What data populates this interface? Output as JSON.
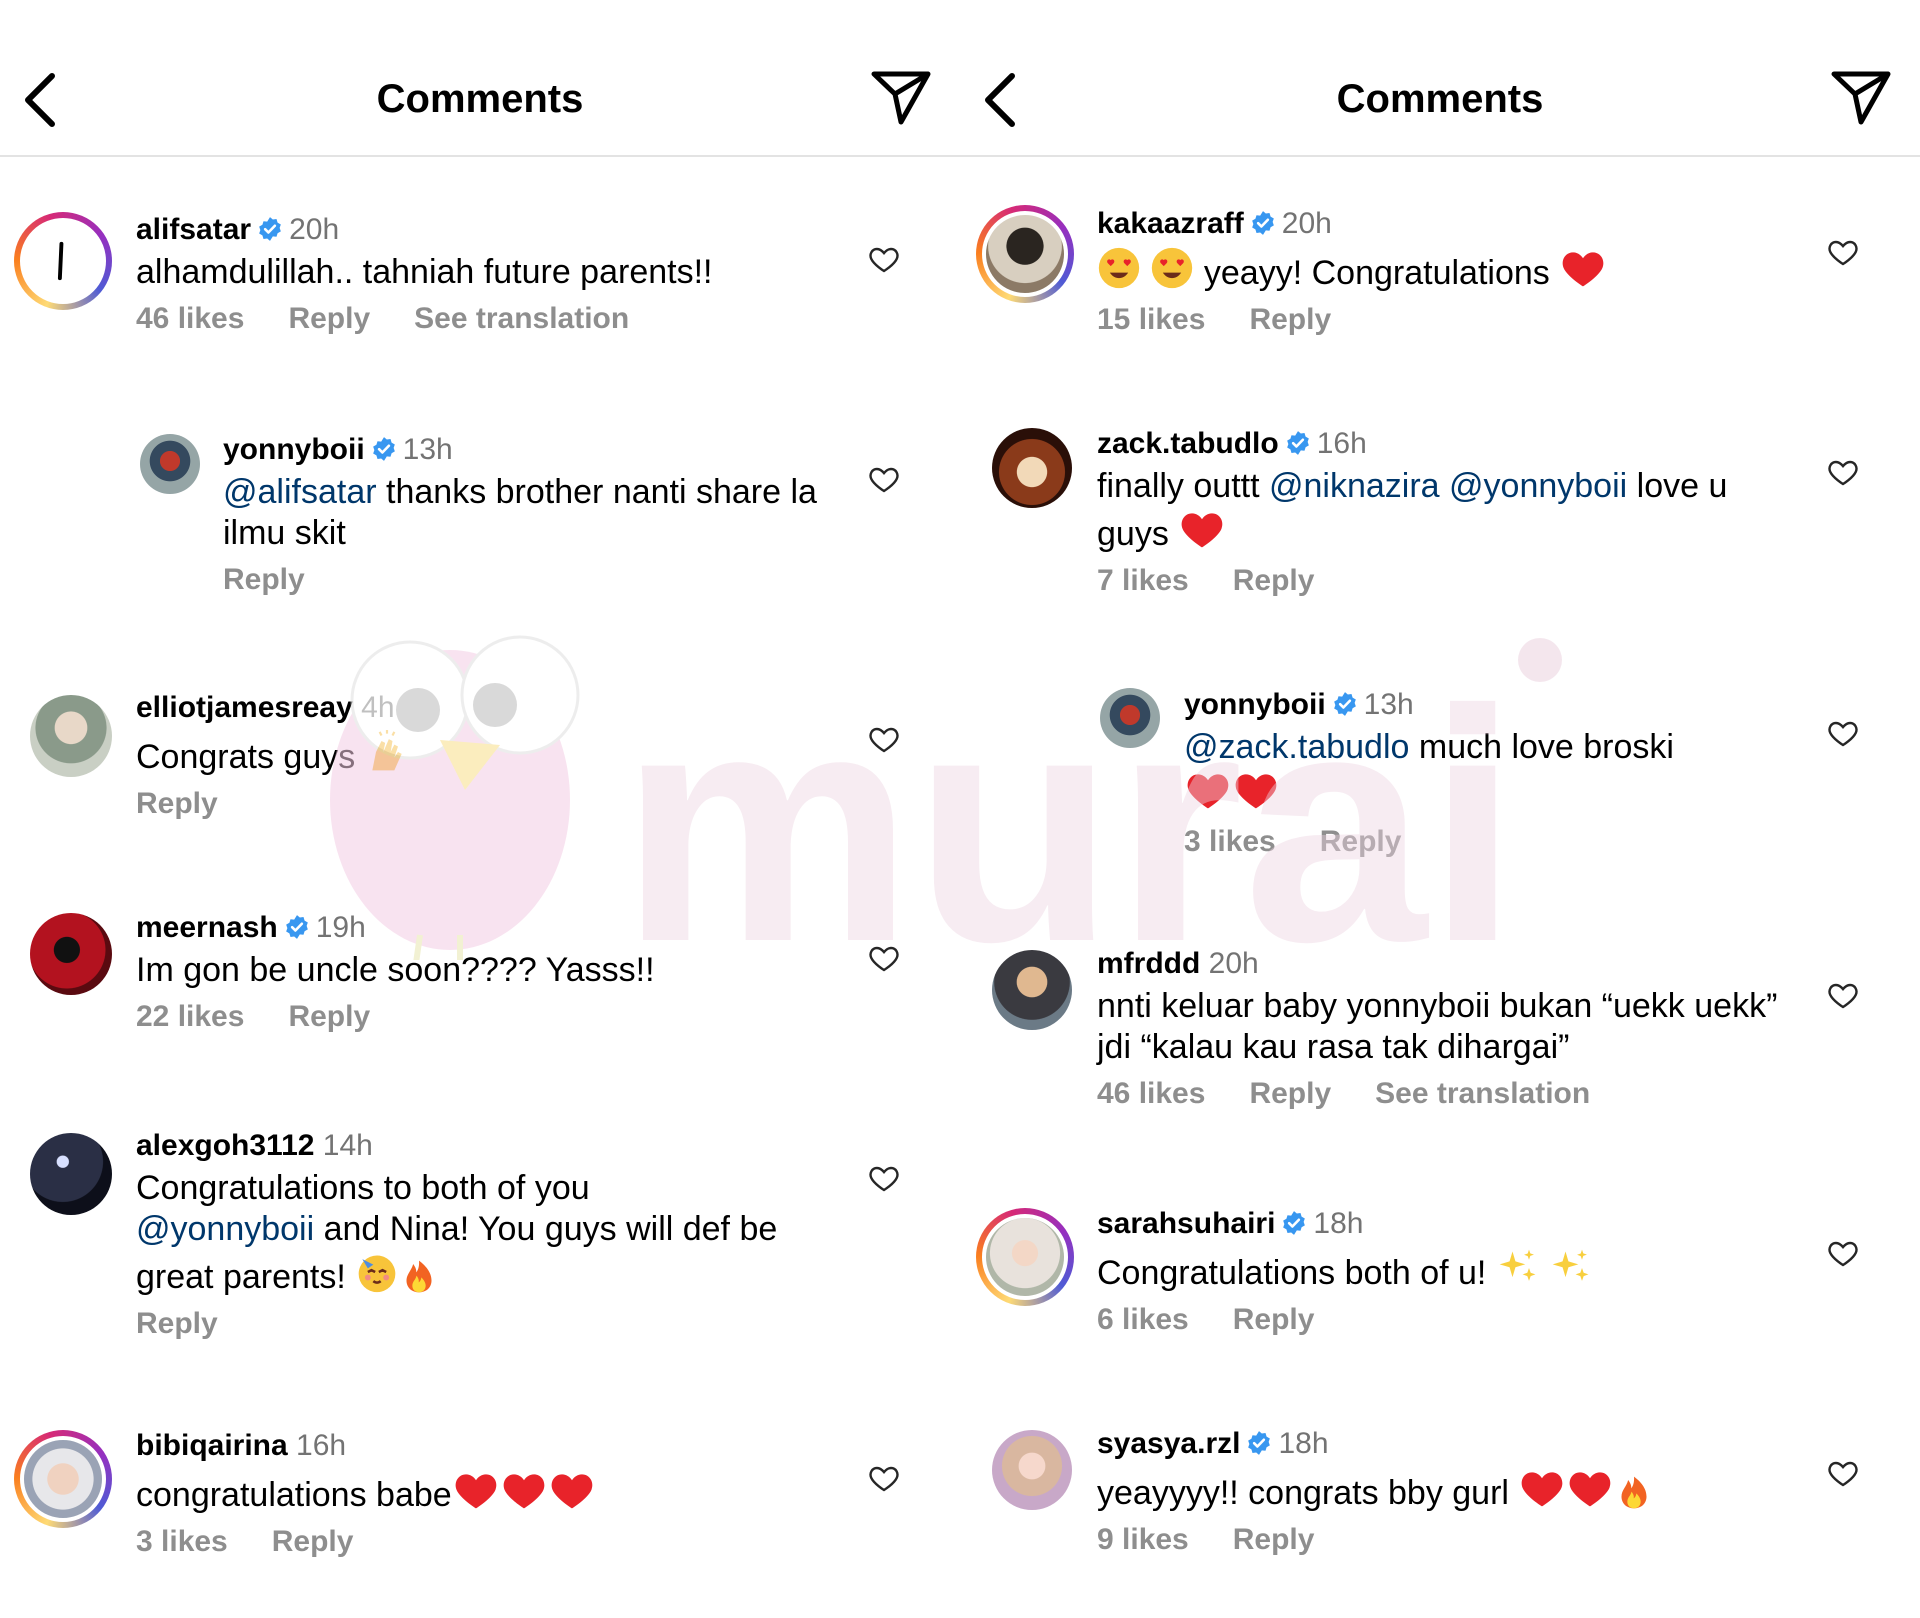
{
  "colors": {
    "mention": "#00376b",
    "secondary_text": "#737373",
    "action_text": "#8e8e8e",
    "verified": "#3897f0",
    "heart": "#e8232a",
    "watermark": "#f2c6e1"
  },
  "left": {
    "header": {
      "title": "Comments",
      "back_icon": "chevron-left-icon",
      "send_icon": "paper-plane-icon"
    },
    "comments": [
      {
        "username": "alifsatar",
        "verified": true,
        "time": "20h",
        "text": "alhamdulillah.. tahniah future parents!!",
        "likes": "46 likes",
        "reply": "Reply",
        "translate": "See translation"
      },
      {
        "username": "yonnyboii",
        "verified": true,
        "time": "13h",
        "mention": "@alifsatar",
        "text": " thanks brother nanti share la ilmu skit",
        "reply": "Reply"
      },
      {
        "username": "elliotjamesreay",
        "verified": false,
        "time": "4h",
        "text": "Congrats guys ",
        "reply": "Reply"
      },
      {
        "username": "meernash",
        "verified": true,
        "time": "19h",
        "text": "Im gon be uncle soon???? Yasss!!",
        "likes": "22 likes",
        "reply": "Reply"
      },
      {
        "username": "alexgoh3112",
        "verified": false,
        "time": "14h",
        "text_a": "Congratulations to both of you",
        "mention": "@yonnyboii",
        "text_b": " and Nina! You guys will def be great parents! ",
        "reply": "Reply"
      },
      {
        "username": "bibiqairina",
        "verified": false,
        "time": "16h",
        "text": "congratulations babe",
        "likes": "3 likes",
        "reply": "Reply"
      }
    ]
  },
  "right": {
    "header": {
      "title": "Comments",
      "back_icon": "chevron-left-icon",
      "send_icon": "paper-plane-icon"
    },
    "comments": [
      {
        "username": "kakaazraff",
        "verified": true,
        "time": "20h",
        "text": " yeayy! Congratulations ",
        "likes": "15 likes",
        "reply": "Reply"
      },
      {
        "username": "zack.tabudlo",
        "verified": true,
        "time": "16h",
        "text_a": "finally outtt ",
        "mention_a": "@niknazira",
        "mention_b": " @yonnyboii",
        "text_b": " love u guys ",
        "likes": "7 likes",
        "reply": "Reply"
      },
      {
        "username": "yonnyboii",
        "verified": true,
        "time": "13h",
        "mention": "@zack.tabudlo",
        "text": " much love broski",
        "likes": "3 likes",
        "reply": "Reply"
      },
      {
        "username": "mfrddd",
        "verified": false,
        "time": "20h",
        "text": "nnti keluar baby yonnyboii bukan “uekk uekk” jdi “kalau kau rasa tak dihargai”",
        "likes": "46 likes",
        "reply": "Reply",
        "translate": "See translation"
      },
      {
        "username": "sarahsuhairi",
        "verified": true,
        "time": "18h",
        "text": "Congratulations both of u! ",
        "likes": "6 likes",
        "reply": "Reply"
      },
      {
        "username": "syasya.rzl",
        "verified": true,
        "time": "18h",
        "text": "yeayyyy!! congrats bby gurl ",
        "likes": "9 likes",
        "reply": "Reply"
      }
    ]
  },
  "watermark": {
    "text": "murai"
  }
}
